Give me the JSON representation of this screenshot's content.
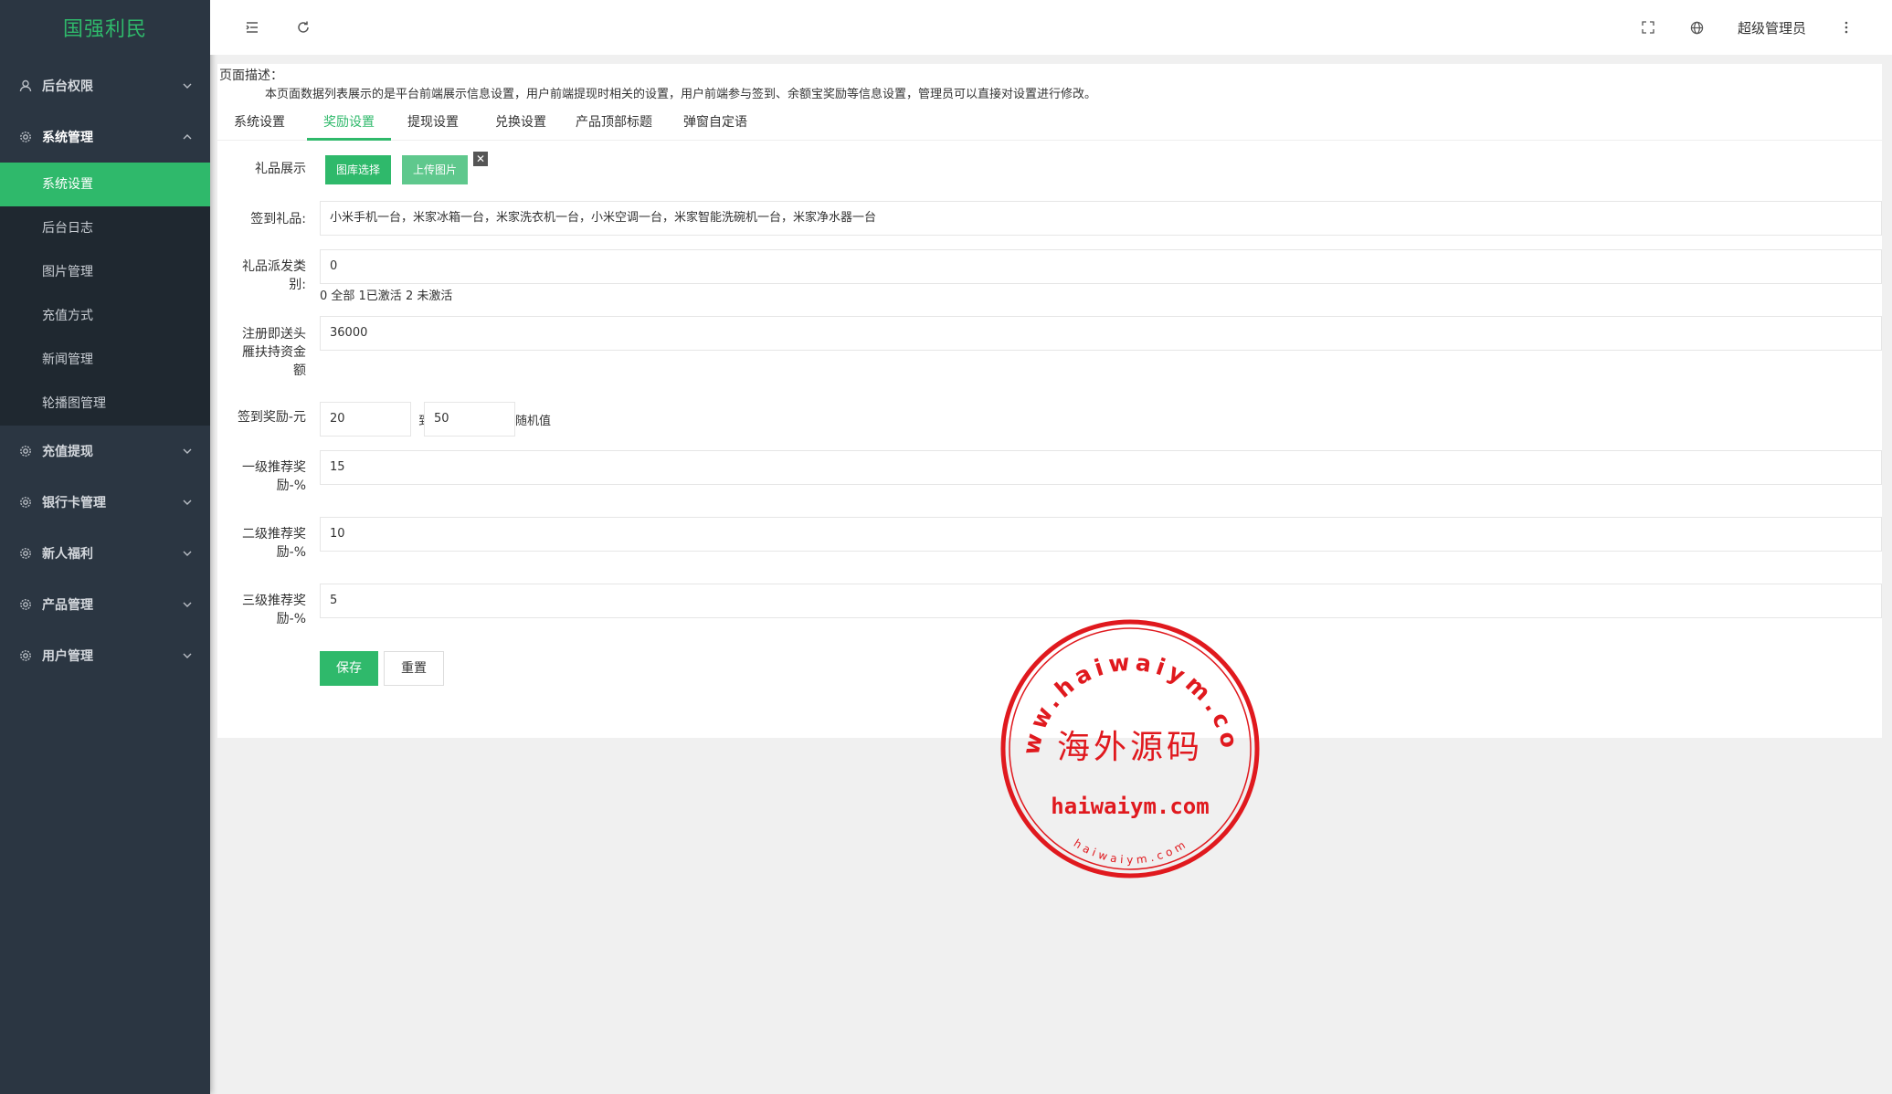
{
  "app": {
    "logo": "国强利民"
  },
  "sidebar": {
    "groups": [
      {
        "label": "后台权限",
        "icon": "user-icon",
        "open": false
      },
      {
        "label": "系统管理",
        "icon": "gear-icon",
        "open": true,
        "items": [
          "系统设置",
          "后台日志",
          "图片管理",
          "充值方式",
          "新闻管理",
          "轮播图管理"
        ],
        "active": "系统设置"
      },
      {
        "label": "充值提现",
        "icon": "gear-icon",
        "open": false
      },
      {
        "label": "银行卡管理",
        "icon": "gear-icon",
        "open": false
      },
      {
        "label": "新人福利",
        "icon": "gear-icon",
        "open": false
      },
      {
        "label": "产品管理",
        "icon": "gear-icon",
        "open": false
      },
      {
        "label": "用户管理",
        "icon": "gear-icon",
        "open": false
      }
    ]
  },
  "header": {
    "icons": [
      "menu-fold-icon",
      "refresh-icon",
      "fullscreen-icon",
      "globe-icon",
      "more-vertical-icon"
    ],
    "admin_name": "超级管理员"
  },
  "page": {
    "desc_title": "页面描述：",
    "desc_text": "本页面数据列表展示的是平台前端展示信息设置，用户前端提现时相关的设置，用户前端参与签到、余额宝奖励等信息设置，管理员可以直接对设置进行修改。",
    "tabs": [
      "系统设置",
      "奖励设置",
      "提现设置",
      "兑换设置",
      "产品顶部标题",
      "弹窗自定语"
    ],
    "active_tab": "奖励设置"
  },
  "form": {
    "gift_display_label": "礼品展示",
    "gallery_btn": "图库选择",
    "upload_btn": "上传图片",
    "close_glyph": "✕",
    "sign_gift_label": "签到礼品:",
    "sign_gift_value": "小米手机一台，米家冰箱一台，米家洗衣机一台，小米空调一台，米家智能洗碗机一台，米家净水器一台",
    "gift_type_label": "礼品派发类别:",
    "gift_type_value": "0",
    "gift_type_hint": "0 全部 1已激活 2 未激活",
    "register_label": "注册即送头雁扶持资金额",
    "register_value": "36000",
    "sign_reward_label": "签到奖励-元",
    "sign_reward_min": "20",
    "sign_reward_to": "到",
    "sign_reward_max": "50",
    "sign_reward_suffix": "随机值",
    "level1_label": "一级推荐奖励-%",
    "level1_value": "15",
    "level2_label": "二级推荐奖励-%",
    "level2_value": "10",
    "level3_label": "三级推荐奖励-%",
    "level3_value": "5",
    "save_btn": "保存",
    "reset_btn": "重置"
  },
  "stamp": {
    "outer_text": "www.haiwaiym.com",
    "center_text": "海外源码",
    "domain_text": "haiwaiym.com",
    "bottom_text": "haiwaiym.com",
    "color": "#e0191e"
  },
  "colors": {
    "accent": "#2fb96b",
    "sidebar_bg": "#2b3642"
  }
}
